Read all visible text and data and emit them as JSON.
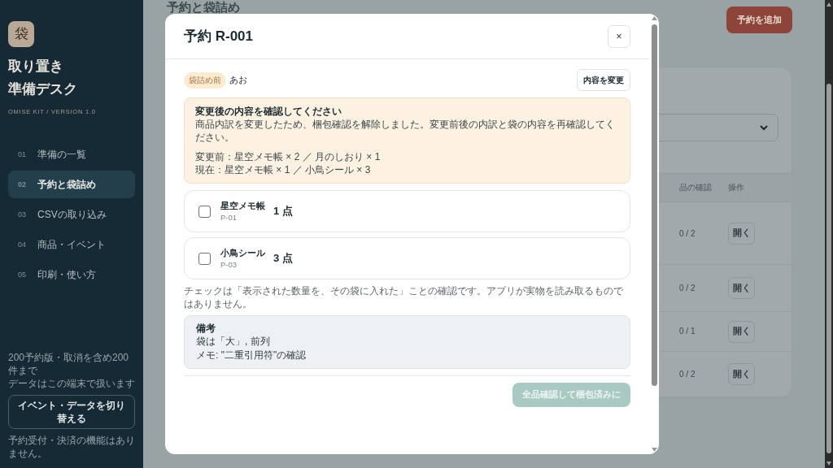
{
  "sidebar": {
    "logo": "袋",
    "title_lines": [
      "取り置き",
      "準備デスク"
    ],
    "subtitle": "OMISE KIT / VERSION 1.0",
    "items": [
      {
        "number": "01",
        "label": "準備の一覧",
        "selected": false
      },
      {
        "number": "02",
        "label": "予約と袋詰め",
        "selected": true
      },
      {
        "number": "03",
        "label": "CSVの取り込み",
        "selected": false
      },
      {
        "number": "04",
        "label": "商品・イベント",
        "selected": false
      },
      {
        "number": "05",
        "label": "印刷・使い方",
        "selected": false
      }
    ],
    "footer_lines": [
      "200予約版・取消を含め200件まで",
      "データはこの端末で扱います"
    ],
    "switch_button": "イベント・データを切り替える",
    "footer_note": "予約受付・決済の機能はありません。"
  },
  "page": {
    "title": "予約と袋詰め",
    "add_button": "予約を追加",
    "table": {
      "columns": [
        "品の確認",
        "操作"
      ],
      "rows": [
        {
          "progress": "0 / 2",
          "action": "開く"
        },
        {
          "progress": "0 / 2",
          "action": "開く"
        },
        {
          "progress": "0 / 1",
          "action": "開く"
        },
        {
          "progress": "0 / 2",
          "action": "開く"
        }
      ]
    }
  },
  "dialog": {
    "title": "予約 R-001",
    "close": "×",
    "status_badge": "袋詰め前",
    "customer": "あお",
    "edit_button": "内容を変更",
    "alert": {
      "heading": "変更後の内容を確認してください",
      "message": "商品内訳を変更したため、梱包確認を解除しました。変更前後の内訳と袋の内容を再確認してください。",
      "before": "変更前：星空メモ帳 × 2 ／ 月のしおり × 1",
      "current": "現在：星空メモ帳 × 1 ／ 小鳥シール × 3"
    },
    "items": [
      {
        "name": "星空メモ帳",
        "code": "P-01",
        "quantity": "1 点",
        "checked": false
      },
      {
        "name": "小鳥シール",
        "code": "P-03",
        "quantity": "3 点",
        "checked": false
      }
    ],
    "note": "チェックは「表示された数量を、その袋に入れた」ことの確認です。アプリが実物を読み取るものではありません。",
    "remarks": {
      "heading": "備考",
      "lines": [
        "袋は「大」, 前列",
        "メモ: \"二重引用符\"の確認"
      ]
    },
    "confirm_button": {
      "label": "全品確認して梱包済みに",
      "disabled": true
    }
  }
}
